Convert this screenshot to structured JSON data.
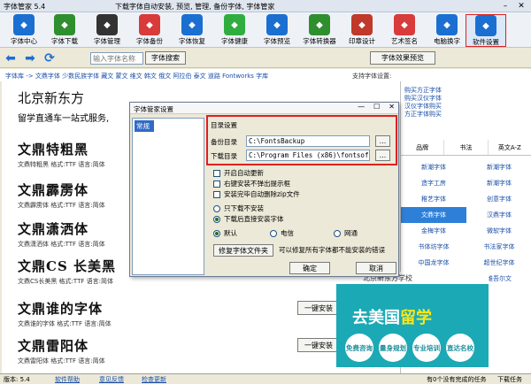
{
  "window": {
    "title": "字体管家 5.4",
    "banner": "下载字体自动安装, 预览, 管理, 备份字体, 字体管家"
  },
  "toolbar": [
    {
      "label": "字体中心",
      "icon": "home-icon",
      "color": "#1b6fd1"
    },
    {
      "label": "字体下载",
      "icon": "download-icon",
      "color": "#2f8f2f"
    },
    {
      "label": "字体管理",
      "icon": "font-manage-icon",
      "color": "#333333"
    },
    {
      "label": "字体备份",
      "icon": "backup-icon",
      "color": "#d93a3a"
    },
    {
      "label": "字体恢复",
      "icon": "restore-icon",
      "color": "#1b6fd1"
    },
    {
      "label": "字体健康",
      "icon": "health-icon",
      "color": "#2fae3f"
    },
    {
      "label": "字体预览",
      "icon": "preview-icon",
      "color": "#1b6fd1"
    },
    {
      "label": "字体转换器",
      "icon": "convert-icon",
      "color": "#2f8f2f"
    },
    {
      "label": "印章设计",
      "icon": "seal-icon",
      "color": "#c0392b"
    },
    {
      "label": "艺术签名",
      "icon": "signature-icon",
      "color": "#d93a3a"
    },
    {
      "label": "电脑换字",
      "icon": "computer-icon",
      "color": "#1b6fd1"
    },
    {
      "label": "软件设置",
      "icon": "gear-icon",
      "color": "#1b6fd1"
    }
  ],
  "nav": {
    "search_placeholder": "输入字体名称",
    "search_button": "字体搜索",
    "preview_button": "字体效果预览"
  },
  "crumb": {
    "text": "字体库 -> 文鼎字体 少数民族字体 藏文 蒙文 维文 韩文 俄文 阿拉伯 泰文 道路 Fontworks 字库",
    "support": "支持字体设置:"
  },
  "ad": {
    "title": "北京新东方",
    "subtitle": "留学直通车一站式服务,"
  },
  "fonts": [
    {
      "sample": "文鼎特粗黑",
      "meta": "文鼎特粗黑  格式:TTF 语言:简体"
    },
    {
      "sample": "文鼎霹雳体",
      "meta": "文鼎霹雳体  格式:TTF 语言:简体"
    },
    {
      "sample": "文鼎潇洒体",
      "meta": "文鼎潇洒体  格式:TTF 语言:简体"
    },
    {
      "sample": "文鼎CS 长美黑",
      "meta": "文鼎CS长美黑  格式:TTF 语言:简体"
    },
    {
      "sample": "文鼎谁的字体",
      "meta": "文鼎谁的字体  格式:TTF 语言:简体"
    },
    {
      "sample": "文鼎雷阳体",
      "meta": "文鼎雷阳体  格式:TTF 语言:简体"
    }
  ],
  "install_label": "一键安装",
  "right": {
    "links": [
      "购买方正字体",
      "购买汉仪字体",
      "汉仪字体购买",
      "方正字体购买"
    ],
    "tabs": [
      "品牌",
      "书法",
      "英文A-Z"
    ],
    "grid": [
      [
        "新潮字体",
        "新潮字体"
      ],
      [
        "造字工房",
        "新潮字体"
      ],
      [
        "稚艺字体",
        "创意字体"
      ],
      [
        "文鼎字体",
        "汉鼎字体"
      ],
      [
        "金梅字体",
        "微软字体"
      ],
      [
        "书体坊字体",
        "书法家字体"
      ],
      [
        "中国龙字体",
        "超世纪字体"
      ],
      [
        "蒙文字体",
        "维吾尔文"
      ]
    ],
    "selected": "文鼎字体"
  },
  "banner_ad": {
    "school": "北京新东方学校",
    "headline_a": "去美国",
    "headline_b": "留学",
    "circles": [
      "免费咨询",
      "量身规划",
      "专业培训",
      "直达名校"
    ]
  },
  "dialog": {
    "title": "字体管家设置",
    "list_item": "常规",
    "group_title": "目录设置",
    "backup_label": "备份目录",
    "backup_path": "C:\\FontsBackup",
    "download_label": "下载目录",
    "download_path": "C:\\Program Files (x86)\\fontsoft\\d",
    "browse": "...",
    "options": [
      "开启自动更新",
      "右键安装不弹出提示框",
      "安装完毕自动删除zip文件"
    ],
    "radio_only": "只下载不安装",
    "radio_install": "下载后直接安装字体",
    "net_default": "默认",
    "net_telecom": "电信",
    "net_cnc": "网通",
    "fix_button": "修复字体文件夹",
    "fix_note": "可以修复所有字体都不能安装的错误",
    "ok": "确定",
    "cancel": "取消"
  },
  "status": {
    "version": "版本: 5.4",
    "help": "软件帮助",
    "feedback": "意见反馈",
    "update": "检查更新",
    "tasks": "有0个没有完成的任务",
    "download_tasks": "下载任务"
  }
}
